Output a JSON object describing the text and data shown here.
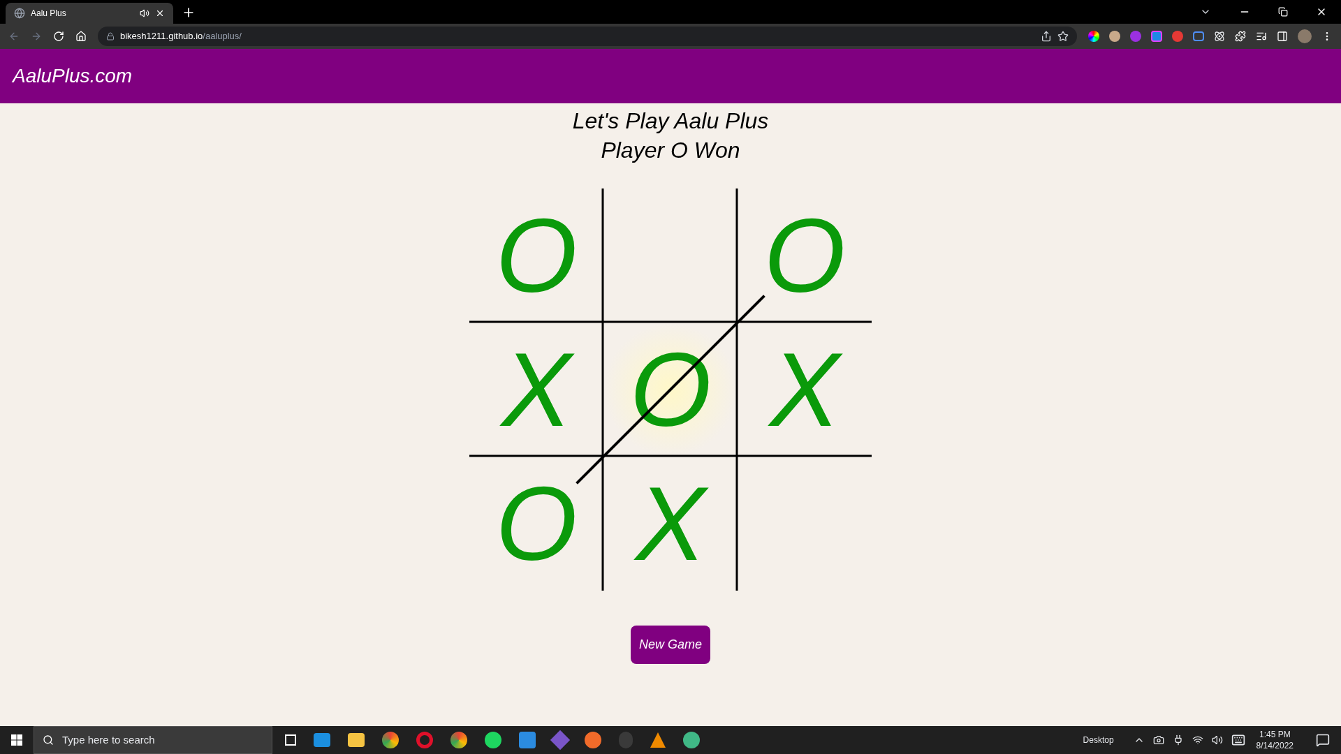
{
  "browser": {
    "tab": {
      "title": "Aalu Plus",
      "selected": true
    },
    "url": {
      "host": "bikesh1211.github.io",
      "path": "/aaluplus/"
    }
  },
  "header": {
    "brand": "AaluPlus.com"
  },
  "game": {
    "title": "Let's Play Aalu Plus",
    "status": "Player O Won",
    "cells": [
      {
        "mark": "O",
        "highlighted": false
      },
      {
        "highlighted": false
      },
      {
        "mark": "O",
        "highlighted": false,
        "in_winning_line": true
      },
      {
        "mark": "X",
        "highlighted": false
      },
      {
        "mark": "O",
        "highlighted": true,
        "in_winning_line": true
      },
      {
        "mark": "X",
        "highlighted": false
      },
      {
        "mark": "O",
        "highlighted": false,
        "in_winning_line": true
      },
      {
        "mark": "X",
        "highlighted": false
      },
      {
        "highlighted": false
      }
    ],
    "button": "New Game"
  },
  "taskbar": {
    "search_placeholder": "Type here to search",
    "toolbar_label": "Desktop",
    "time": "1:45 PM",
    "date": "8/14/2022"
  }
}
